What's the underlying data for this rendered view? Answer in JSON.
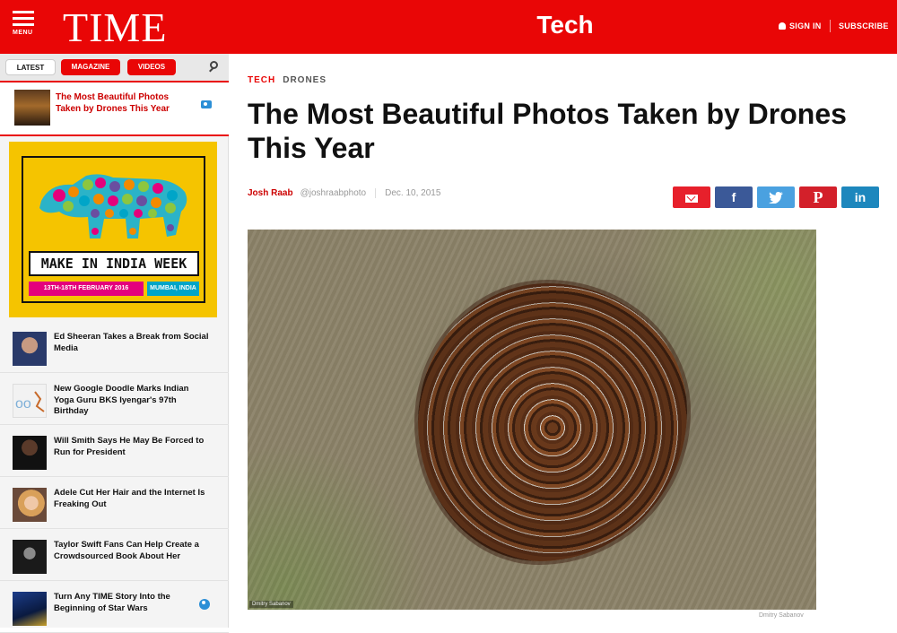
{
  "header": {
    "menu_label": "MENU",
    "logo": "TIME",
    "section": "Tech",
    "sign_in": "SIGN IN",
    "subscribe": "SUBSCRIBE",
    "brand_color": "#e90606"
  },
  "sidebar": {
    "tabs": [
      "LATEST",
      "MAGAZINE",
      "VIDEOS"
    ],
    "active_item": {
      "title": "The Most Beautiful Photos Taken by Drones This Year",
      "icon": "camera-icon"
    },
    "ad": {
      "title": "MAKE IN INDIA WEEK",
      "dates": "13TH-18TH FEBRUARY 2016",
      "city": "MUMBAI, INDIA"
    },
    "items": [
      {
        "title": "Ed Sheeran Takes a Break from Social Media"
      },
      {
        "title": "New Google Doodle Marks Indian Yoga Guru BKS Iyengar's 97th Birthday"
      },
      {
        "title": "Will Smith Says He May Be Forced to Run for President"
      },
      {
        "title": "Adele Cut Her Hair and the Internet Is Freaking Out"
      },
      {
        "title": "Taylor Swift Fans Can Help Create a Crowdsourced Book About Her"
      },
      {
        "title": "Turn Any TIME Story Into the Beginning of Star Wars"
      }
    ]
  },
  "article": {
    "kicker_section": "TECH",
    "kicker_topic": "DRONES",
    "headline": "The Most Beautiful Photos Taken by Drones This Year",
    "author": "Josh Raab",
    "handle": "@joshraabphoto",
    "date": "Dec. 10, 2015",
    "share": {
      "facebook": "f",
      "twitter": "t",
      "pinterest": "P",
      "linkedin": "in"
    },
    "photo_credit": "Dmitry Sabanov"
  }
}
